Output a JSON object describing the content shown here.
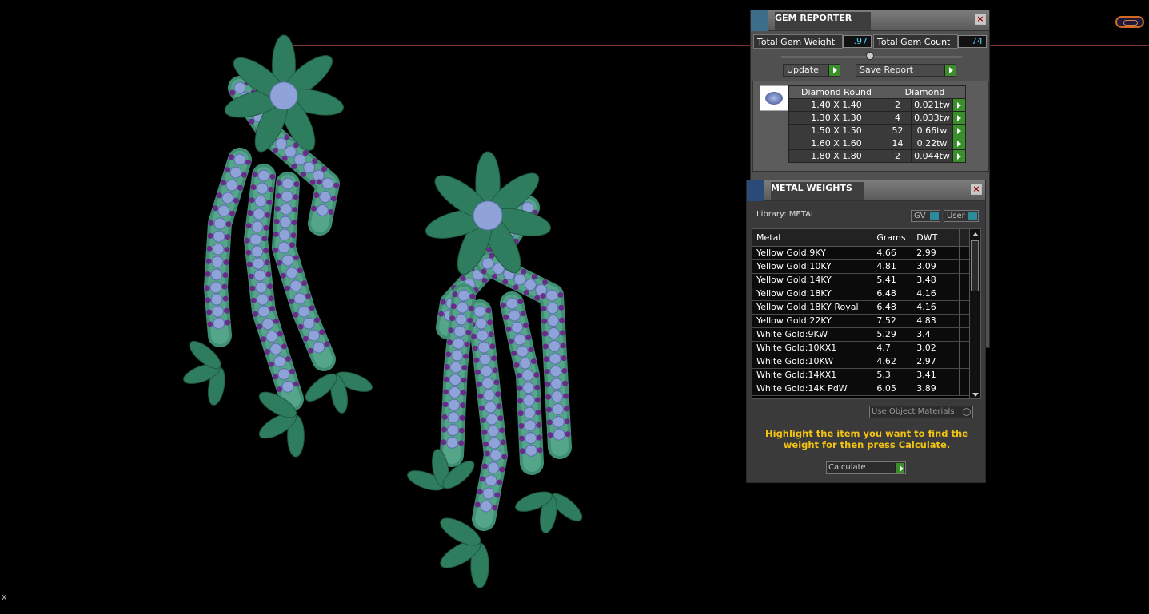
{
  "gem_reporter": {
    "title": "GEM REPORTER",
    "total_weight_label": "Total Gem Weight",
    "total_weight_value": ".97",
    "total_count_label": "Total Gem Count",
    "total_count_value": "74",
    "update_label": "Update",
    "save_report_label": "Save Report",
    "table": {
      "headers": [
        "Diamond Round",
        "Diamond"
      ],
      "rows": [
        {
          "size": "1.40 X 1.40",
          "count": "2",
          "weight": "0.021tw"
        },
        {
          "size": "1.30 X 1.30",
          "count": "4",
          "weight": "0.033tw"
        },
        {
          "size": "1.50 X 1.50",
          "count": "52",
          "weight": "0.66tw"
        },
        {
          "size": "1.60 X 1.60",
          "count": "14",
          "weight": "0.22tw"
        },
        {
          "size": "1.80 X 1.80",
          "count": "2",
          "weight": "0.044tw"
        }
      ]
    }
  },
  "metal_weights": {
    "title": "METAL WEIGHTS",
    "library_label": "Library: METAL",
    "gv_label": "GV",
    "user_label": "User",
    "columns": [
      "Metal",
      "Grams",
      "DWT"
    ],
    "rows": [
      {
        "metal": "Yellow Gold:9KY",
        "grams": "4.66",
        "dwt": "2.99"
      },
      {
        "metal": "Yellow Gold:10KY",
        "grams": "4.81",
        "dwt": "3.09"
      },
      {
        "metal": "Yellow Gold:14KY",
        "grams": "5.41",
        "dwt": "3.48"
      },
      {
        "metal": "Yellow Gold:18KY",
        "grams": "6.48",
        "dwt": "4.16"
      },
      {
        "metal": "Yellow Gold:18KY Royal",
        "grams": "6.48",
        "dwt": "4.16"
      },
      {
        "metal": "Yellow Gold:22KY",
        "grams": "7.52",
        "dwt": "4.83"
      },
      {
        "metal": "White Gold:9KW",
        "grams": "5.29",
        "dwt": "3.4"
      },
      {
        "metal": "White Gold:10KX1",
        "grams": "4.7",
        "dwt": "3.02"
      },
      {
        "metal": "White Gold:10KW",
        "grams": "4.62",
        "dwt": "2.97"
      },
      {
        "metal": "White Gold:14KX1",
        "grams": "5.3",
        "dwt": "3.41"
      },
      {
        "metal": "White Gold:14K PdW",
        "grams": "6.05",
        "dwt": "3.89"
      }
    ],
    "use_object_materials_label": "Use Object Materials",
    "hint_text": "Highlight the item you want to find the weight for then press Calculate.",
    "calculate_label": "Calculate"
  },
  "viewport": {
    "corner_label": "x"
  },
  "colors": {
    "leaf": "#2e7d5e",
    "stone": "#8fa3d9",
    "accent_stone": "#6a2a8a",
    "hint": "#f2c312",
    "value": "#4fd2ff"
  }
}
